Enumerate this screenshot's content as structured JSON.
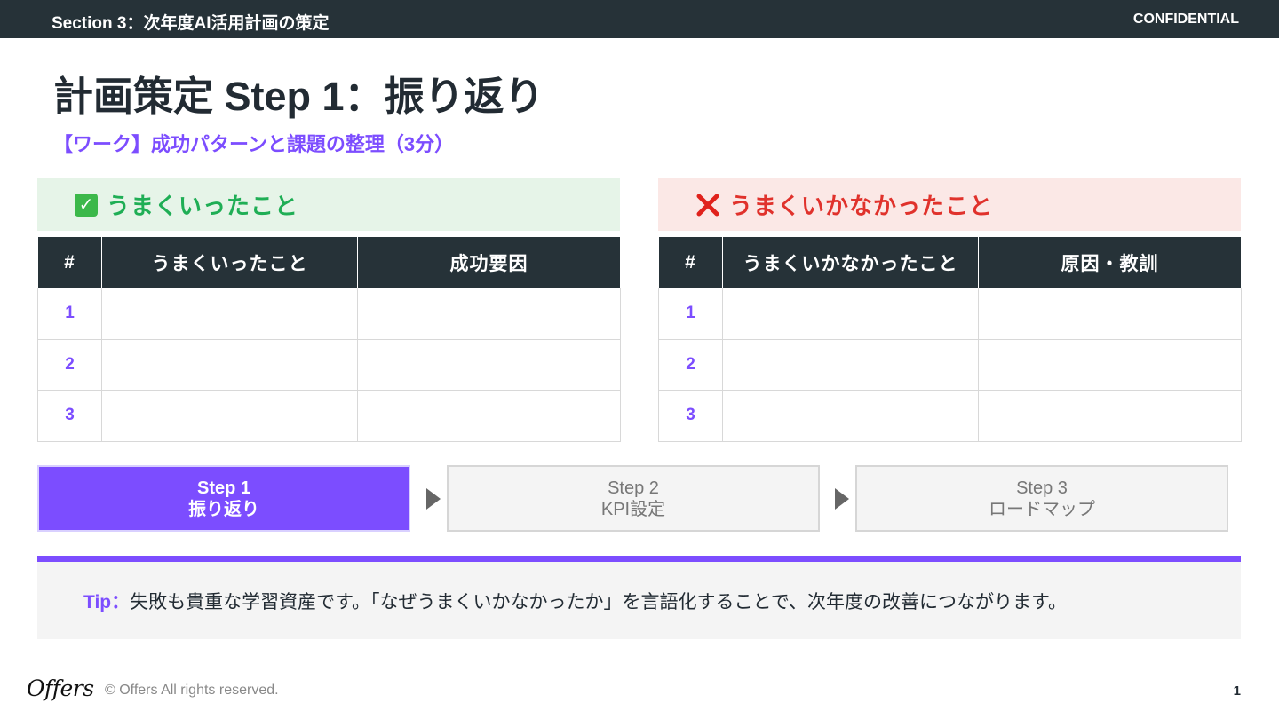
{
  "header": {
    "section": "Section 3：次年度AI活用計画の策定",
    "confidential": "CONFIDENTIAL"
  },
  "title": "計画策定 Step 1：振り返り",
  "subtitle": "【ワーク】成功パターンと課題の整理（3分）",
  "panels": {
    "success": {
      "icon": "check-icon",
      "label": "うまくいったこと",
      "columns": [
        "#",
        "うまくいったこと",
        "成功要因"
      ],
      "rows": [
        {
          "num": "1",
          "item": "",
          "reason": ""
        },
        {
          "num": "2",
          "item": "",
          "reason": ""
        },
        {
          "num": "3",
          "item": "",
          "reason": ""
        }
      ]
    },
    "failure": {
      "icon": "cross-icon",
      "label": "うまくいかなかったこと",
      "columns": [
        "#",
        "うまくいかなかったこと",
        "原因・教訓"
      ],
      "rows": [
        {
          "num": "1",
          "item": "",
          "reason": ""
        },
        {
          "num": "2",
          "item": "",
          "reason": ""
        },
        {
          "num": "3",
          "item": "",
          "reason": ""
        }
      ]
    }
  },
  "steps": [
    {
      "line1": "Step 1",
      "line2": "振り返り",
      "active": true
    },
    {
      "line1": "Step 2",
      "line2": "KPI設定",
      "active": false
    },
    {
      "line1": "Step 3",
      "line2": "ロードマップ",
      "active": false
    }
  ],
  "tip": {
    "label": "Tip：",
    "text": "失敗も貴重な学習資産です。「なぜうまくいかなかったか」を言語化することで、次年度の改善につながります。"
  },
  "footer": {
    "logo": "Offers",
    "copyright": "© Offers All rights reserved.",
    "page": "1"
  },
  "colors": {
    "accent": "#7c4dff",
    "header_bg": "#263238",
    "success": "#1fae55",
    "failure": "#e0322c"
  }
}
